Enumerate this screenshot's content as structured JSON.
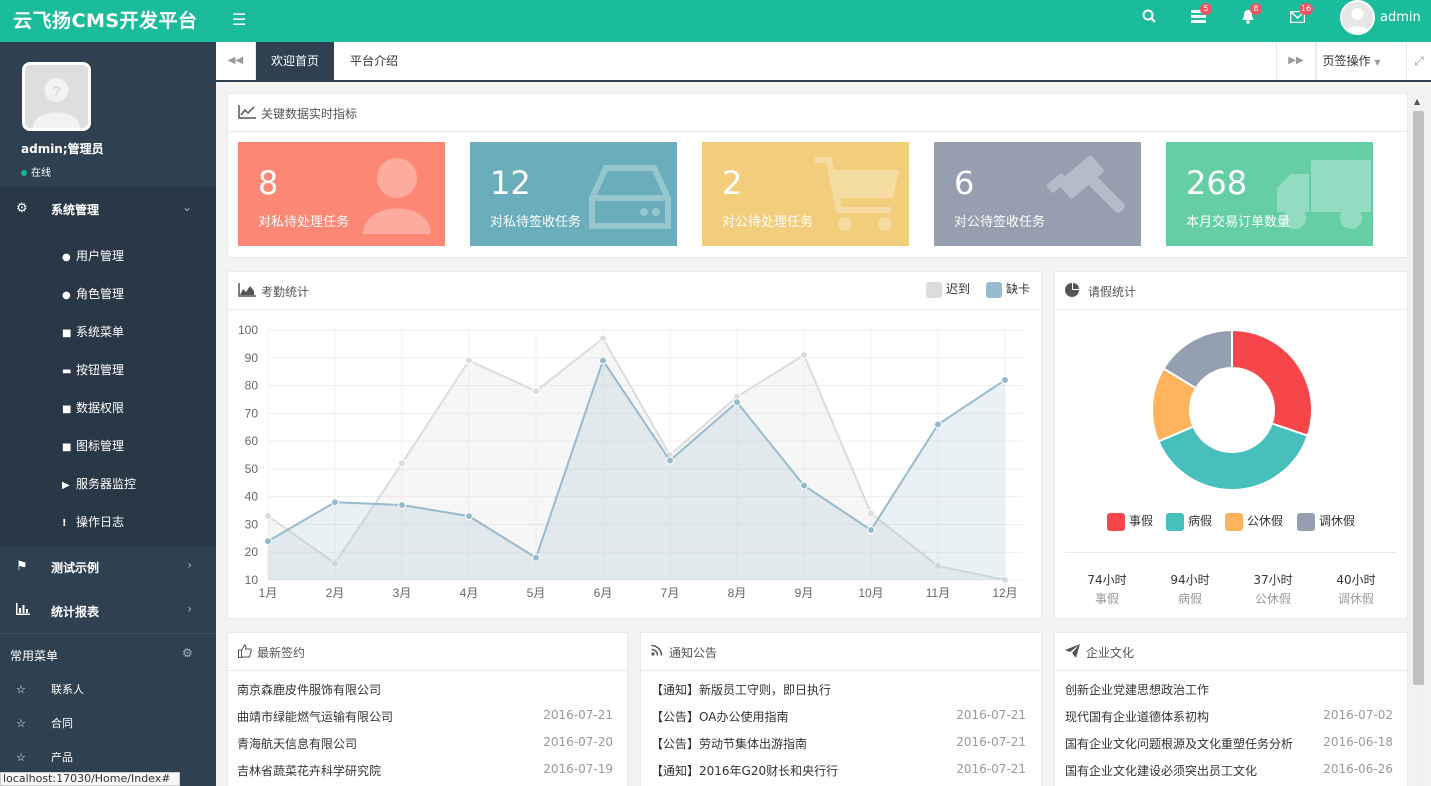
{
  "app": {
    "brand": "云飞扬CMS开发平台",
    "user": "admin"
  },
  "badges": {
    "tasks": "5",
    "alerts": "8",
    "messages": "16"
  },
  "profile": {
    "name": "admin;管理员",
    "status": "在线"
  },
  "sidebar": {
    "groups": [
      {
        "label": "系统管理",
        "icon": "cogs-icon"
      },
      {
        "label": "测试示例",
        "icon": "tags-icon"
      },
      {
        "label": "统计报表",
        "icon": "bar-chart-icon"
      }
    ],
    "submenu": [
      {
        "label": "用户管理",
        "icon": "user-icon"
      },
      {
        "label": "角色管理",
        "icon": "users-icon"
      },
      {
        "label": "系统菜单",
        "icon": "sitemap-icon"
      },
      {
        "label": "按钮管理",
        "icon": "credit-card-icon"
      },
      {
        "label": "数据权限",
        "icon": "lock-icon"
      },
      {
        "label": "图标管理",
        "icon": "lock-icon"
      },
      {
        "label": "服务器监控",
        "icon": "video-icon"
      },
      {
        "label": "操作日志",
        "icon": "exclamation-icon"
      }
    ],
    "common_title": "常用菜单",
    "common": [
      "联系人",
      "合同",
      "产品"
    ],
    "status_url": "localhost:17030/Home/Index#"
  },
  "tabs": {
    "items": [
      "欢迎首页",
      "平台介绍"
    ],
    "ops": "页签操作"
  },
  "kpi": {
    "title": "关键数据实时指标",
    "cards": [
      {
        "value": "8",
        "label": "对私待处理任务",
        "color": "#fb8774",
        "icon": "user-icon"
      },
      {
        "value": "12",
        "label": "对私待签收任务",
        "color": "#6aaebb",
        "icon": "hdd-icon"
      },
      {
        "value": "2",
        "label": "对公待处理任务",
        "color": "#f2cd7b",
        "icon": "cart-icon"
      },
      {
        "value": "6",
        "label": "对公待签收任务",
        "color": "#959fb0",
        "icon": "gavel-icon"
      },
      {
        "value": "268",
        "label": "本月交易订单数量",
        "color": "#65cea7",
        "icon": "truck-icon"
      }
    ]
  },
  "attendance": {
    "title": "考勤统计",
    "legend": [
      "迟到",
      "缺卡"
    ]
  },
  "leave": {
    "title": "请假统计",
    "legend": [
      "事假",
      "病假",
      "公休假",
      "调休假"
    ],
    "stats": [
      {
        "value": "74小时",
        "label": "事假"
      },
      {
        "value": "94小时",
        "label": "病假"
      },
      {
        "value": "37小时",
        "label": "公休假"
      },
      {
        "value": "40小时",
        "label": "调休假"
      }
    ]
  },
  "contracts": {
    "title": "最新签约",
    "rows": [
      {
        "name": "南京森鹿皮件服饰有限公司",
        "date": ""
      },
      {
        "name": "曲靖市绿能燃气运输有限公司",
        "date": "2016-07-21"
      },
      {
        "name": "青海航天信息有限公司",
        "date": "2016-07-20"
      },
      {
        "name": "吉林省蔬菜花卉科学研究院",
        "date": "2016-07-19"
      }
    ]
  },
  "notices": {
    "title": "通知公告",
    "rows": [
      {
        "name": "【通知】新版员工守则，即日执行",
        "date": ""
      },
      {
        "name": "【公告】OA办公使用指南",
        "date": "2016-07-21"
      },
      {
        "name": "【公告】劳动节集体出游指南",
        "date": "2016-07-21"
      },
      {
        "name": "【通知】2016年G20财长和央行行",
        "date": "2016-07-21"
      }
    ]
  },
  "culture": {
    "title": "企业文化",
    "rows": [
      {
        "name": "创新企业党建思想政治工作",
        "date": ""
      },
      {
        "name": "现代国有企业道德体系初构",
        "date": "2016-07-02"
      },
      {
        "name": "国有企业文化问题根源及文化重塑任务分析",
        "date": "2016-06-18"
      },
      {
        "name": "国有企业文化建设必须突出员工文化",
        "date": "2016-06-26"
      }
    ]
  },
  "chart_data": [
    {
      "type": "area",
      "categories": [
        "1月",
        "2月",
        "3月",
        "4月",
        "5月",
        "6月",
        "7月",
        "8月",
        "9月",
        "10月",
        "11月",
        "12月"
      ],
      "series": [
        {
          "name": "迟到",
          "values": [
            33,
            16,
            52,
            89,
            78,
            97,
            55,
            76,
            91,
            34,
            15,
            10
          ],
          "color": "#dcdcdc"
        },
        {
          "name": "缺卡",
          "values": [
            24,
            38,
            37,
            33,
            18,
            89,
            53,
            74,
            44,
            28,
            66,
            82
          ],
          "color": "#97bbcd"
        }
      ],
      "ylim": [
        10,
        100
      ],
      "yticks": [
        100,
        90,
        80,
        70,
        60,
        50,
        40,
        30,
        20,
        10
      ],
      "grid": true,
      "legend": "top-right"
    },
    {
      "type": "pie",
      "categories": [
        "事假",
        "病假",
        "公休假",
        "调休假"
      ],
      "values": [
        74,
        94,
        37,
        40
      ],
      "colors": [
        "#f7464a",
        "#46bfbd",
        "#fdb45c",
        "#949fb1"
      ],
      "legend": "bottom"
    }
  ]
}
